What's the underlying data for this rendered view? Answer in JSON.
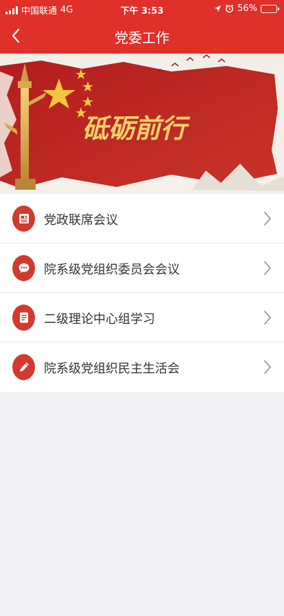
{
  "status_bar": {
    "carrier": "中国联通",
    "network": "4G",
    "time": "下午 3:53",
    "battery": "56%",
    "battery_level": 0.56
  },
  "nav": {
    "title": "党委工作",
    "back_icon": "chevron-left-icon"
  },
  "banner": {
    "calligraphy_text": "砥砺前行"
  },
  "menu": {
    "items": [
      {
        "label": "党政联席会议",
        "icon": "newspaper-icon"
      },
      {
        "label": "院系级党组织委员会会议",
        "icon": "chat-bubble-icon"
      },
      {
        "label": "二级理论中心组学习",
        "icon": "document-icon"
      },
      {
        "label": "院系级党组织民主生活会",
        "icon": "pencil-icon"
      }
    ]
  },
  "colors": {
    "header": "#e0302a",
    "icon_bg": "#d13a2e",
    "page_bg": "#efeff4"
  }
}
